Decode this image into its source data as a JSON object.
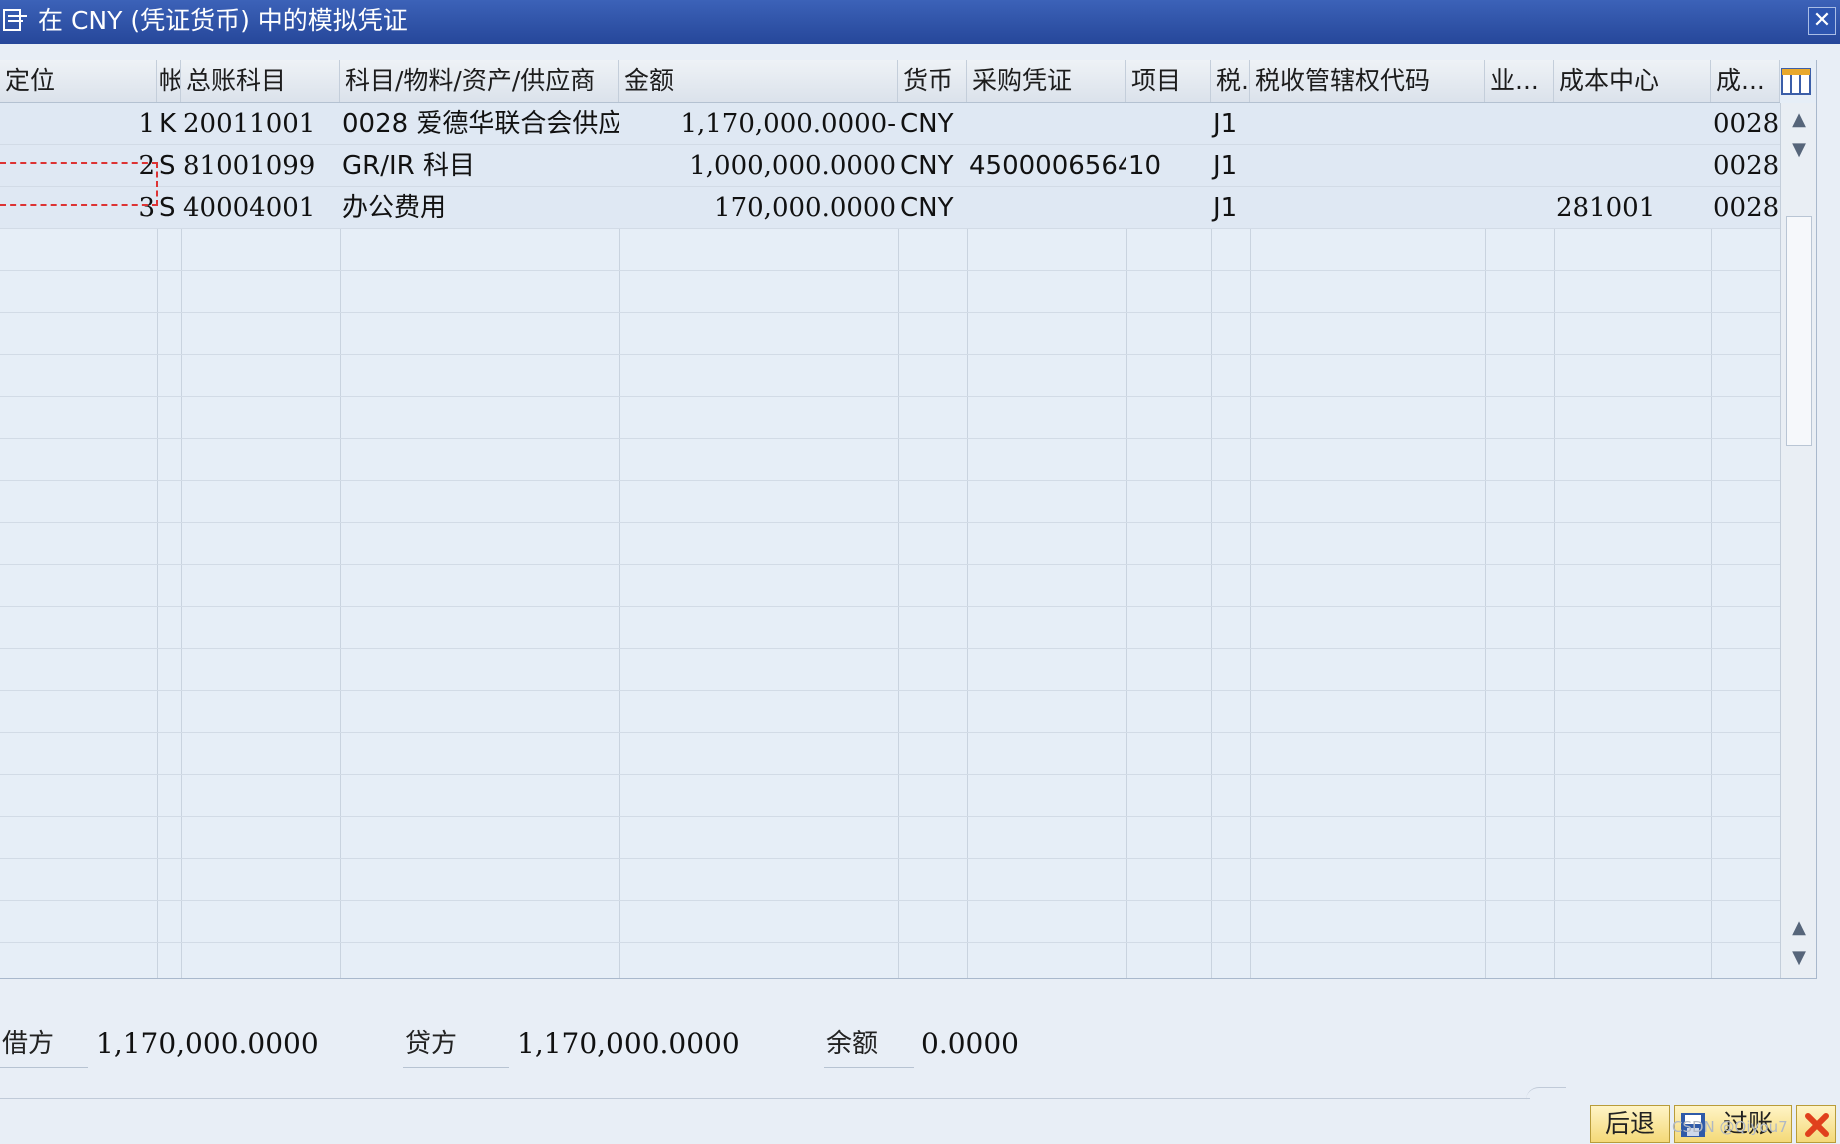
{
  "window": {
    "title": "在 CNY (凭证货币) 中的模拟凭证",
    "close_glyph": "✕"
  },
  "columns": [
    "定位",
    "帐",
    "总账科目",
    "科目/物料/资产/供应商",
    "金额",
    "货币",
    "采购凭证",
    "项目",
    "税.",
    "税收管辖权代码",
    "业...",
    "成本中心",
    "成..."
  ],
  "rows": [
    {
      "pos": "1",
      "type": "K",
      "gl": "20011001",
      "account": "0028 爱德华联合会供应...",
      "amount": "1,170,000.0000-",
      "currency": "CNY",
      "po": "",
      "item": "",
      "tax": "J1",
      "jurisdiction": "",
      "biz": "",
      "cost_center": "",
      "cc2": "0028"
    },
    {
      "pos": "2",
      "type": "S",
      "gl": "81001099",
      "account": "GR/IR 科目",
      "amount": "1,000,000.0000",
      "currency": "CNY",
      "po": "4500006564",
      "item": "10",
      "tax": "J1",
      "jurisdiction": "",
      "biz": "",
      "cost_center": "",
      "cc2": "0028"
    },
    {
      "pos": "3",
      "type": "S",
      "gl": "40004001",
      "account": "办公费用",
      "amount": "170,000.0000",
      "currency": "CNY",
      "po": "",
      "item": "",
      "tax": "J1",
      "jurisdiction": "",
      "biz": "",
      "cost_center": "281001",
      "cc2": "0028"
    }
  ],
  "empty_row_count": 17,
  "totals": {
    "debit_label": "借方",
    "debit_value": "1,170,000.0000",
    "credit_label": "贷方",
    "credit_value": "1,170,000.0000",
    "balance_label": "余额",
    "balance_value": "0.0000"
  },
  "buttons": {
    "back": "后退",
    "post": "过账"
  },
  "watermark": "CSDN @Qiyou7"
}
